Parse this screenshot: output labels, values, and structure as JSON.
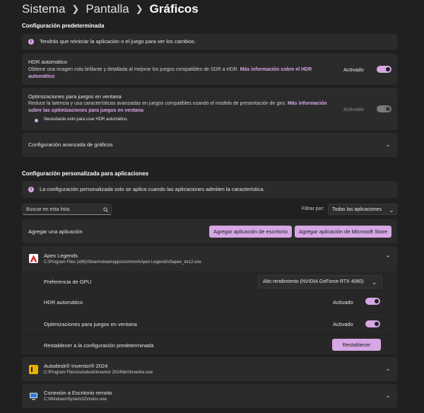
{
  "breadcrumb": {
    "level1": "Sistema",
    "level2": "Pantalla",
    "current": "Gráficos"
  },
  "default_config": {
    "title": "Configuración predeterminada",
    "restart_notice": "Tendrás que reiniciar la aplicación o el juego para ver los cambios.",
    "hdr": {
      "title": "HDR automático",
      "description": "Obtiene una imagen más brillante y detallada al mejorar los juegos compatibles de SDR a HDR.",
      "link": "Más información sobre el HDR automático",
      "status": "Activado"
    },
    "windowed": {
      "title": "Optimizaciones para juegos en ventana",
      "description": "Reduce la latencia y usa características avanzadas en juegos compatibles usando el modelo de presentación de giro.",
      "link": "Más información sobre las optimizaciones para juegos en ventana",
      "note": "Necesitarás esto para usar HDR automático.",
      "status": "Activado"
    },
    "advanced": {
      "title": "Configuración avanzada de gráficos"
    }
  },
  "custom_config": {
    "title": "Configuración personalizada para aplicaciones",
    "notice": "La configuración personalizada solo se aplica cuando las aplicaciones admiten la característica.",
    "search_placeholder": "Buscar en esta lista",
    "filter_label": "Filtrar por:",
    "filter_value": "Todas las aplicaciones",
    "add_app_label": "Agregar una aplicación",
    "add_desktop_button": "Agregar aplicación de escritorio",
    "add_store_button": "Agregar aplicación de Microsoft Store"
  },
  "apps": [
    {
      "name": "Apex Legends",
      "path": "C:\\Program Files (x86)\\Steam\\steamapps\\common\\Apex Legends\\r5apex_dx12.exe",
      "icon": "apex-legends-icon",
      "expanded": true,
      "gpu_label": "Preferencia de GPU",
      "gpu_value": "Alto rendimiento (NVIDIA GeForce RTX 4060)",
      "hdr_label": "HDR automático",
      "hdr_status": "Activado",
      "windowed_label": "Optimizaciones para juegos en ventana",
      "windowed_status": "Activado",
      "reset_label": "Restablecer a la configuración predeterminada",
      "reset_button": "Restablecer"
    },
    {
      "name": "Autodesk® Inventor® 2024",
      "path": "C:\\Program Files\\Autodesk\\Inventor 2024\\bin\\Inventor.exe",
      "icon": "autodesk-inventor-icon",
      "expanded": false
    },
    {
      "name": "Conexión a Escritorio remoto",
      "path": "C:\\Windows\\System32\\mstsc.exe",
      "icon": "remote-desktop-icon",
      "expanded": false
    }
  ],
  "colors": {
    "accent": "#d6a7e4",
    "background": "#202020",
    "card": "#2b2b2b"
  }
}
